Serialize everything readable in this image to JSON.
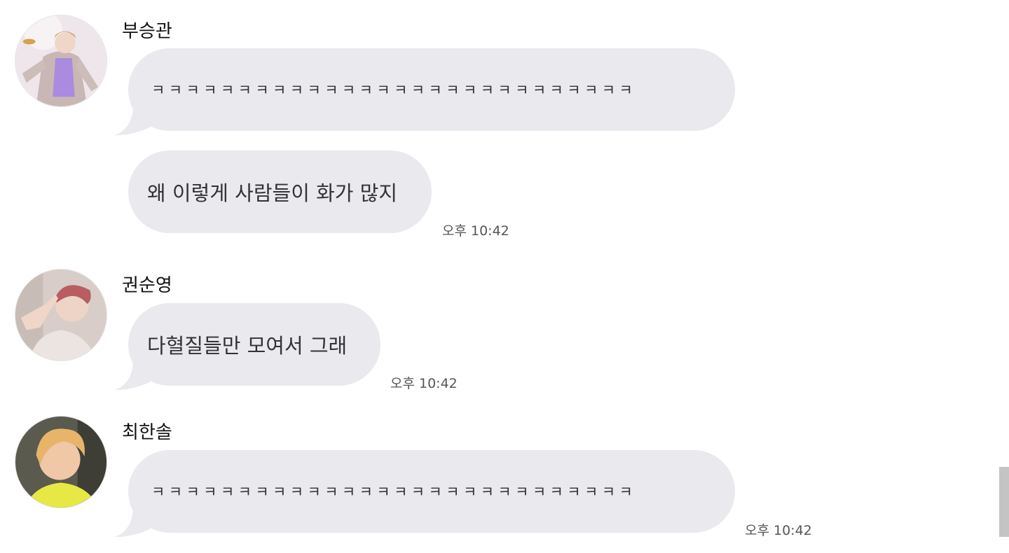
{
  "colors": {
    "bubble": "#e9e9ee",
    "text": "#333333",
    "sender": "#111111",
    "timestamp": "#555555",
    "scrollbar": "#c4c4c4"
  },
  "messages": [
    {
      "sender": "부승관",
      "avatar_icon": "profile-photo",
      "bubbles": [
        "ㅋㅋㅋㅋㅋㅋㅋㅋㅋㅋㅋㅋㅋㅋㅋㅋㅋㅋㅋㅋㅋㅋㅋㅋㅋㅋㅋㅋ",
        "왜 이렇게 사람들이 화가 많지"
      ],
      "time": "오후 10:42"
    },
    {
      "sender": "권순영",
      "avatar_icon": "profile-photo",
      "bubbles": [
        "다혈질들만 모여서 그래"
      ],
      "time": "오후 10:42"
    },
    {
      "sender": "최한솔",
      "avatar_icon": "profile-photo",
      "bubbles": [
        "ㅋㅋㅋㅋㅋㅋㅋㅋㅋㅋㅋㅋㅋㅋㅋㅋㅋㅋㅋㅋㅋㅋㅋㅋㅋㅋㅋㅋ"
      ],
      "time": "오후 10:42"
    }
  ]
}
